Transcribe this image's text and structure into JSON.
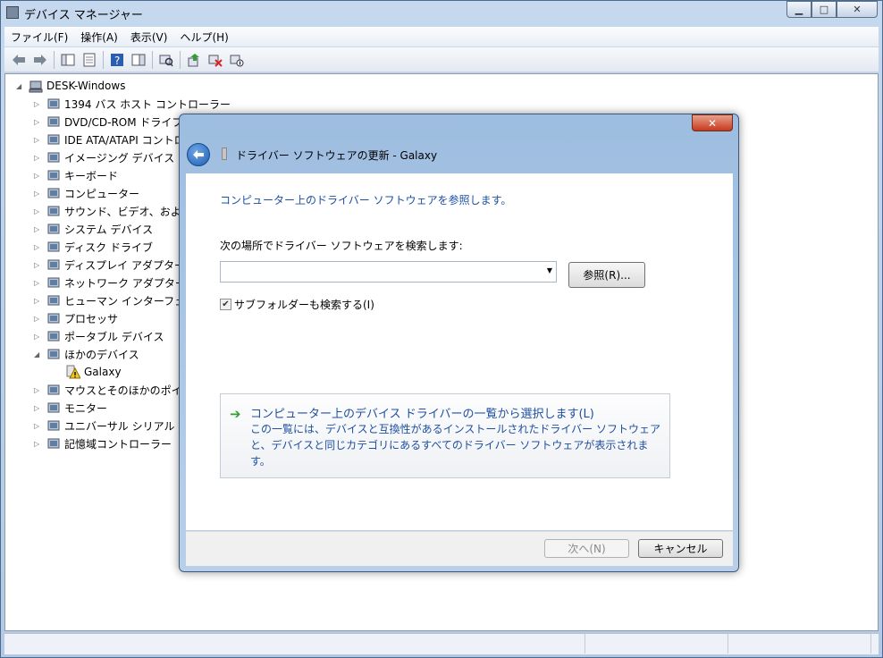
{
  "window": {
    "title": "デバイス マネージャー",
    "min": "▁",
    "max": "□",
    "close": "✕"
  },
  "menu": [
    "ファイル(F)",
    "操作(A)",
    "表示(V)",
    "ヘルプ(H)"
  ],
  "tree": {
    "root": "DESK-Windows",
    "items": [
      {
        "label": "1394 バス ホスト コントローラー",
        "icon": "firewire-icon"
      },
      {
        "label": "DVD/CD-ROM ドライブ",
        "icon": "dvd-drive-icon"
      },
      {
        "label": "IDE ATA/ATAPI コントローラー",
        "icon": "ide-controller-icon"
      },
      {
        "label": "イメージング デバイス",
        "icon": "camera-icon"
      },
      {
        "label": "キーボード",
        "icon": "keyboard-icon"
      },
      {
        "label": "コンピューター",
        "icon": "computer-icon"
      },
      {
        "label": "サウンド、ビデオ、およびゲーム コントローラー",
        "icon": "speaker-icon"
      },
      {
        "label": "システム デバイス",
        "icon": "system-device-icon"
      },
      {
        "label": "ディスク ドライブ",
        "icon": "disk-drive-icon"
      },
      {
        "label": "ディスプレイ アダプター",
        "icon": "display-adapter-icon"
      },
      {
        "label": "ネットワーク アダプター",
        "icon": "network-adapter-icon"
      },
      {
        "label": "ヒューマン インターフェイス デバイス",
        "icon": "hid-icon"
      },
      {
        "label": "プロセッサ",
        "icon": "processor-icon"
      },
      {
        "label": "ポータブル デバイス",
        "icon": "portable-device-icon"
      },
      {
        "label": "ほかのデバイス",
        "icon": "other-devices-icon"
      },
      {
        "label": "Galaxy",
        "icon": "warning-icon"
      },
      {
        "label": "マウスとそのほかのポインティング デバイス",
        "icon": "mouse-icon"
      },
      {
        "label": "モニター",
        "icon": "monitor-icon"
      },
      {
        "label": "ユニバーサル シリアル バス コントローラー",
        "icon": "usb-icon"
      },
      {
        "label": "記憶域コントローラー",
        "icon": "storage-controller-icon"
      }
    ]
  },
  "dialog": {
    "title": "ドライバー ソフトウェアの更新 - Galaxy",
    "close": "✕",
    "heading": "コンピューター上のドライバー ソフトウェアを参照します。",
    "search_label": "次の場所でドライバー ソフトウェアを検索します:",
    "path_value": "",
    "browse": "参照(R)...",
    "include_subfolders": "サブフォルダーも検索する(I)",
    "include_subfolders_checked": true,
    "pick_title": "コンピューター上のデバイス ドライバーの一覧から選択します(L)",
    "pick_desc": "この一覧には、デバイスと互換性があるインストールされたドライバー ソフトウェアと、デバイスと同じカテゴリにあるすべてのドライバー ソフトウェアが表示されます。",
    "next": "次へ(N)",
    "cancel": "キャンセル"
  }
}
